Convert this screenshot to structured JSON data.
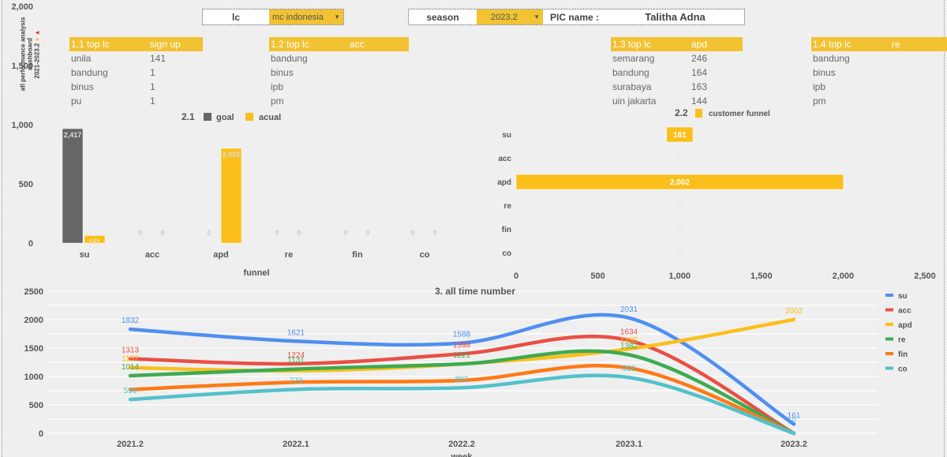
{
  "sidebar_title": {
    "line1": "afl performance analysis",
    "line2": "dashboard",
    "line3": "2021-2023.2"
  },
  "filters": {
    "lc_label": "lc",
    "lc_value": "mc indonesia",
    "season_label": "season",
    "season_value": "2023.2",
    "pic_label": "PIC name :",
    "pic_value": "Talitha Adna"
  },
  "tables": [
    {
      "title": "1.1 top lc",
      "metric": "sign up",
      "rows": [
        [
          "unila",
          "141"
        ],
        [
          "bandung",
          "1"
        ],
        [
          "binus",
          "1"
        ],
        [
          "pu",
          "1"
        ]
      ]
    },
    {
      "title": "1.2 top lc",
      "metric": "acc",
      "rows": [
        [
          "bandung",
          ""
        ],
        [
          "binus",
          ""
        ],
        [
          "ipb",
          ""
        ],
        [
          "pm",
          ""
        ]
      ]
    },
    {
      "title": "1.3 top lc",
      "metric": "apd",
      "rows": [
        [
          "semarang",
          "246"
        ],
        [
          "bandung",
          "164"
        ],
        [
          "surabaya",
          "163"
        ],
        [
          "uin jakarta",
          "144"
        ]
      ]
    },
    {
      "title": "1.4 top lc",
      "metric": "re",
      "rows": [
        [
          "bandung",
          ""
        ],
        [
          "binus",
          ""
        ],
        [
          "ipb",
          ""
        ],
        [
          "pm",
          ""
        ]
      ]
    }
  ],
  "colors": {
    "accent": "#f1c232",
    "goal": "#666666",
    "su": "#4f8ff0",
    "acc": "#ea4f44",
    "apd": "#fbbf1c",
    "re": "#3faa52",
    "fin": "#fd7a16",
    "co": "#53c1cb"
  },
  "chart_data": [
    {
      "type": "bar",
      "title": "2.1",
      "xlabel": "funnel",
      "categories": [
        "su",
        "acc",
        "apd",
        "re",
        "fin",
        "co"
      ],
      "series": [
        {
          "name": "goal",
          "values": [
            2417,
            0,
            0,
            0,
            0,
            0
          ]
        },
        {
          "name": "acual",
          "values": [
            161,
            0,
            2002,
            0,
            0,
            0
          ]
        }
      ],
      "ylim": [
        0,
        2500
      ],
      "yticks": [
        "0",
        "500",
        "1,000",
        "1,500",
        "2,000",
        "2,500"
      ],
      "data_labels": {
        "goal": [
          "2,417",
          "0",
          "0",
          "0",
          "0",
          "0"
        ],
        "acual": [
          "161",
          "0",
          "2,002",
          "0",
          "0",
          "0"
        ]
      },
      "legend": "top"
    },
    {
      "type": "bar",
      "orientation": "horizontal-funnel",
      "title": "2.2",
      "categories": [
        "su",
        "acc",
        "apd",
        "re",
        "fin",
        "co"
      ],
      "series": [
        {
          "name": "customer funnel",
          "values": [
            161,
            0,
            2002,
            0,
            0,
            0
          ]
        }
      ],
      "data_labels": [
        "161",
        "0",
        "2,002",
        "0",
        "0",
        "0"
      ],
      "xlim": [
        0,
        2500
      ],
      "xticks": [
        "0",
        "500",
        "1,000",
        "1,500",
        "2,000",
        "2,500"
      ],
      "legend": "top"
    },
    {
      "type": "line",
      "title": "3. all time number",
      "xlabel": "week",
      "categories": [
        "2021.2",
        "2022.1",
        "2022.2",
        "2023.1",
        "2023.2"
      ],
      "ylim": [
        0,
        2500
      ],
      "yticks": [
        "0",
        "500",
        "1000",
        "1500",
        "2000",
        "2500"
      ],
      "grid": true,
      "legend": "right",
      "series": [
        {
          "name": "su",
          "values": [
            1832,
            1621,
            1588,
            2031,
            161
          ],
          "labels": [
            "1832",
            "1621",
            "1588",
            "2031",
            "161"
          ]
        },
        {
          "name": "acc",
          "values": [
            1313,
            1224,
            1398,
            1634,
            0
          ],
          "labels": [
            "1313",
            "1224",
            "1398",
            "1634",
            ""
          ]
        },
        {
          "name": "apd",
          "values": [
            1157,
            1100,
            1220,
            1485,
            2002
          ],
          "labels": [
            "1157",
            "",
            "",
            "1485",
            "2002"
          ]
        },
        {
          "name": "re",
          "values": [
            1014,
            1131,
            1221,
            1382,
            0
          ],
          "labels": [
            "1014",
            "1131",
            "1221",
            "1382",
            ""
          ]
        },
        {
          "name": "fin",
          "values": [
            770,
            900,
            930,
            1150,
            0
          ],
          "labels": [
            "",
            "",
            "",
            "",
            ""
          ]
        },
        {
          "name": "co",
          "values": [
            596,
            773,
            802,
            983,
            0
          ],
          "labels": [
            "596",
            "773",
            "802",
            "983",
            "0"
          ]
        }
      ]
    }
  ]
}
